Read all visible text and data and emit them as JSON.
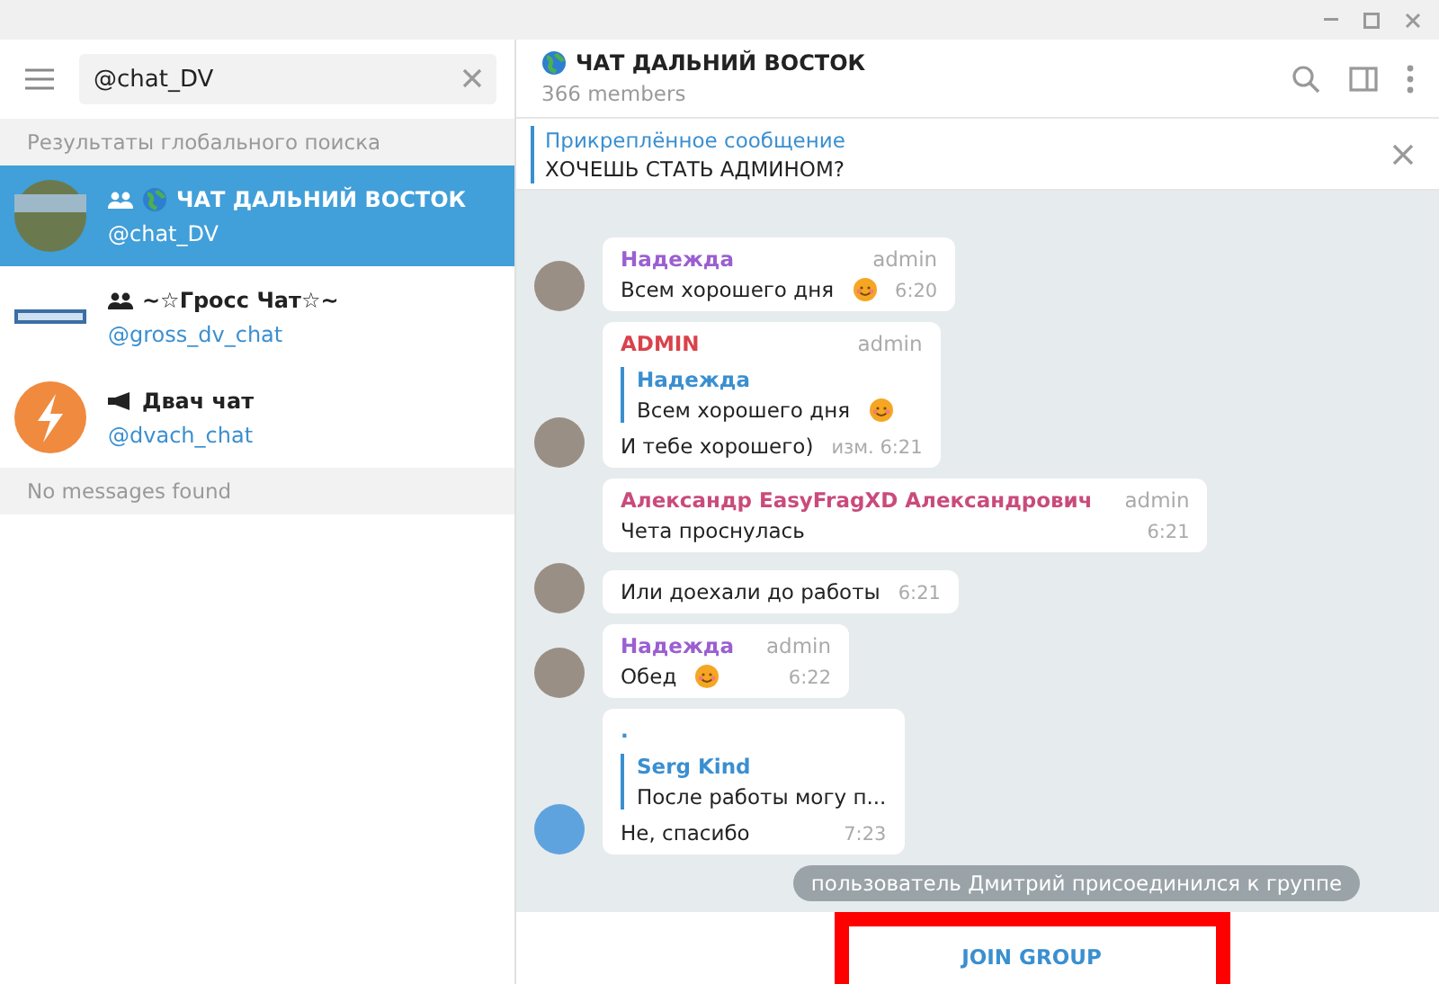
{
  "search": {
    "value": "@chat_DV"
  },
  "section_title": "Результаты глобального поиска",
  "results": [
    {
      "title": "ЧАТ ДАЛЬНИЙ ВОСТОК",
      "kind": "group",
      "globe": true,
      "handle": "@chat_DV",
      "selected": true,
      "avatar": {
        "kind": "photo"
      }
    },
    {
      "title": "~☆Гросс Чат☆~",
      "kind": "group",
      "globe": false,
      "handle": "@gross_dv_chat",
      "selected": false,
      "avatar": {
        "kind": "logo"
      }
    },
    {
      "title": "Двач чат",
      "kind": "channel",
      "globe": false,
      "handle": "@dvach_chat",
      "selected": false,
      "avatar": {
        "kind": "bolt"
      }
    }
  ],
  "empty_note": "No messages found",
  "chat": {
    "title": "ЧАТ ДАЛЬНИЙ ВОСТОК",
    "members": "366 members"
  },
  "pinned": {
    "label": "Прикреплённое сообщение",
    "text": "ХОЧЕШЬ СТАТЬ АДМИНОМ?"
  },
  "messages": [
    {
      "author": "Надежда",
      "color": "#9b5fd1",
      "badge": "admin",
      "text": "Всем хорошего дня",
      "emoji": true,
      "time": "6:20",
      "avatar": {
        "kind": "photo"
      }
    },
    {
      "author": "ADMIN",
      "color": "#d9434b",
      "badge": "admin",
      "reply": {
        "author": "Надежда",
        "text": "Всем хорошего дня",
        "emoji": true
      },
      "text": "И тебе хорошего)",
      "emoji": false,
      "time": "изм. 6:21",
      "avatar": {
        "kind": "photo"
      }
    },
    {
      "author": "Александр EasyFragXD Александрович",
      "color": "#c94b7b",
      "badge": "admin",
      "text": "Чета проснулась",
      "emoji": false,
      "time": "6:21",
      "avatar": {
        "kind": "none"
      }
    },
    {
      "text": "Или доехали до работы",
      "emoji": false,
      "time": "6:21",
      "avatar": {
        "kind": "photo"
      }
    },
    {
      "author": "Надежда",
      "color": "#9b5fd1",
      "badge": "admin",
      "text": "Обед",
      "emoji": true,
      "time": "6:22",
      "avatar": {
        "kind": "photo"
      }
    },
    {
      "author": ".",
      "color": "#3a8fd0",
      "reply": {
        "author": "Serg Kind",
        "text": "После работы могу п...",
        "emoji": false
      },
      "text": "Не, спасибо",
      "emoji": false,
      "time": "7:23",
      "avatar": {
        "kind": "circle"
      }
    }
  ],
  "service_note": "пользователь Дмитрий присоединился к группе",
  "join_button": "JOIN GROUP"
}
